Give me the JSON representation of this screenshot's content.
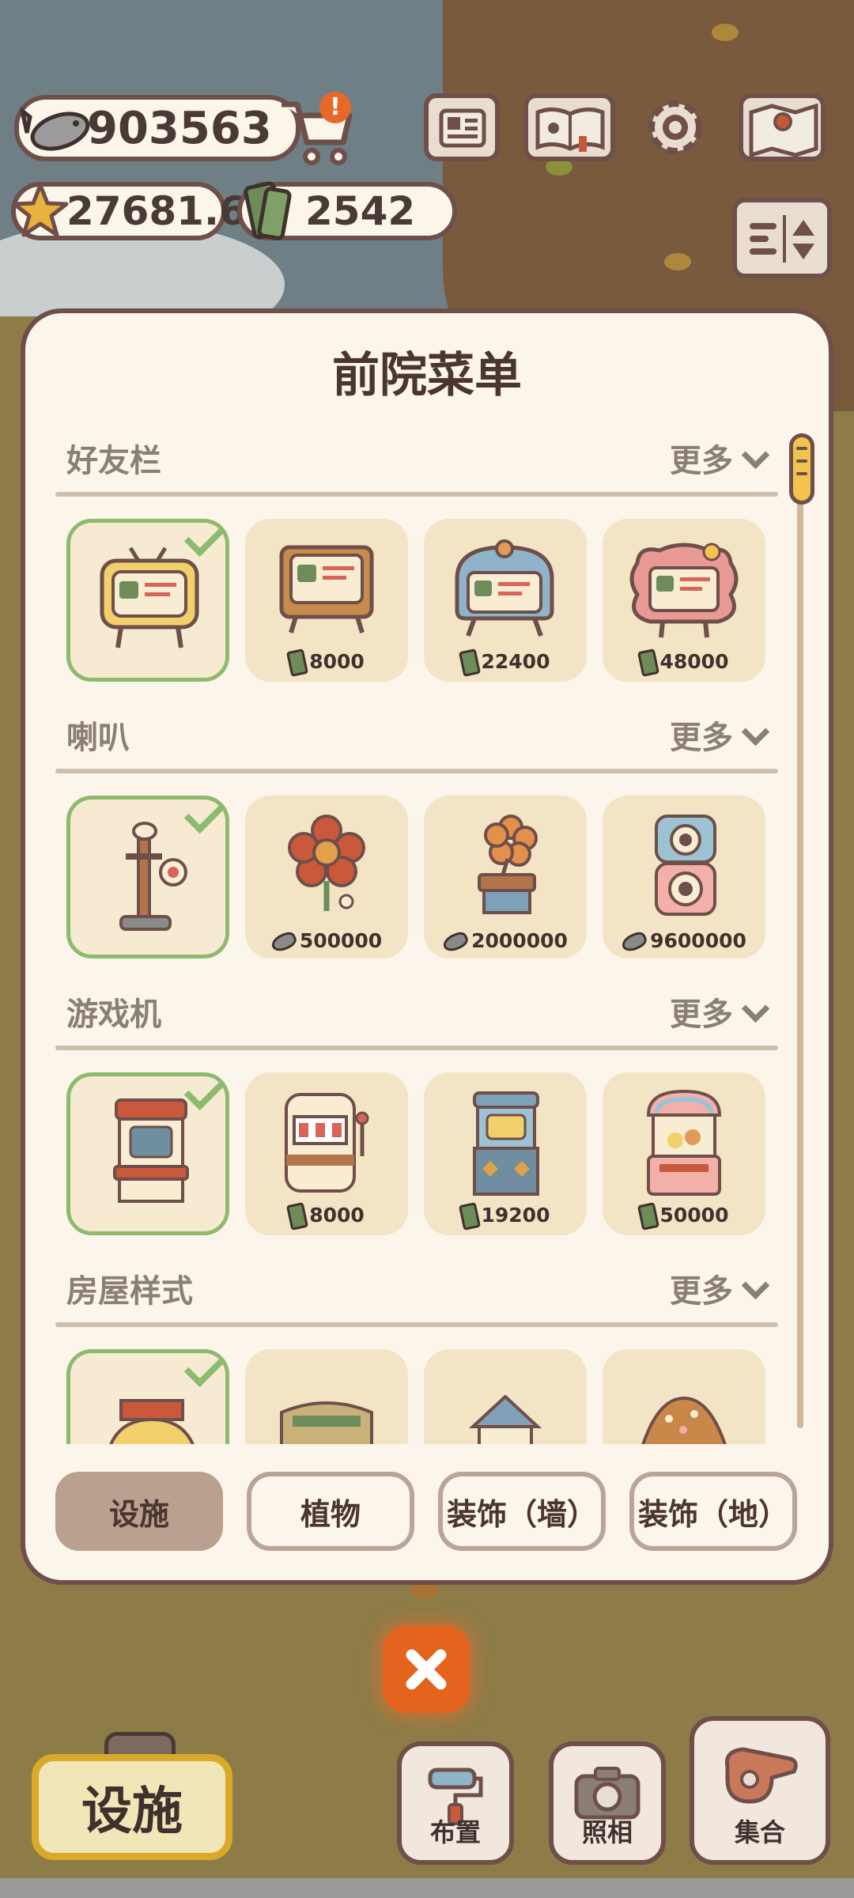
{
  "hud": {
    "fish": "903563",
    "stars": "27681.6",
    "tickets": "2542",
    "cart_badge": "!"
  },
  "panel": {
    "title": "前院菜单",
    "more_label": "更多",
    "sections": [
      {
        "title": "好友栏",
        "items": [
          {
            "owned": true,
            "icon": "tv-stand-yellow-icon"
          },
          {
            "price": "8000",
            "currency": "ticket",
            "icon": "retro-tv-icon"
          },
          {
            "price": "22400",
            "currency": "ticket",
            "icon": "blue-tv-icon"
          },
          {
            "price": "48000",
            "currency": "ticket",
            "icon": "flower-tv-icon"
          }
        ]
      },
      {
        "title": "喇叭",
        "items": [
          {
            "owned": true,
            "icon": "bird-post-speaker-icon"
          },
          {
            "price": "500000",
            "currency": "fish",
            "icon": "flower-speaker-icon"
          },
          {
            "price": "2000000",
            "currency": "fish",
            "icon": "gramophone-icon"
          },
          {
            "price": "9600000",
            "currency": "fish",
            "icon": "speaker-stack-icon"
          }
        ]
      },
      {
        "title": "游戏机",
        "items": [
          {
            "owned": true,
            "icon": "arcade-machine-icon"
          },
          {
            "price": "8000",
            "currency": "ticket",
            "icon": "slot-machine-icon"
          },
          {
            "price": "19200",
            "currency": "ticket",
            "icon": "cat-arcade-icon"
          },
          {
            "price": "50000",
            "currency": "ticket",
            "icon": "claw-machine-icon"
          }
        ]
      },
      {
        "title": "房屋样式",
        "items": [
          {
            "owned": true,
            "icon": "house-style-1-icon"
          },
          {
            "icon": "house-style-2-icon"
          },
          {
            "icon": "house-style-3-icon"
          },
          {
            "icon": "house-style-4-icon"
          }
        ]
      }
    ],
    "tabs": [
      {
        "label": "设施",
        "active": true
      },
      {
        "label": "植物",
        "active": false
      },
      {
        "label": "装饰（墙）",
        "active": false
      },
      {
        "label": "装饰（地）",
        "active": false
      }
    ]
  },
  "bottom": {
    "mode_label": "设施",
    "arrange_label": "布置",
    "photo_label": "照相",
    "gather_label": "集合"
  },
  "colors": {
    "panel_bg": "#fbf5ec",
    "border": "#6e4f4a",
    "owned_green": "#8dbb6e",
    "item_bg": "#f3e4c5",
    "close_orange": "#e4631d",
    "accent_yellow": "#f2c44f"
  }
}
